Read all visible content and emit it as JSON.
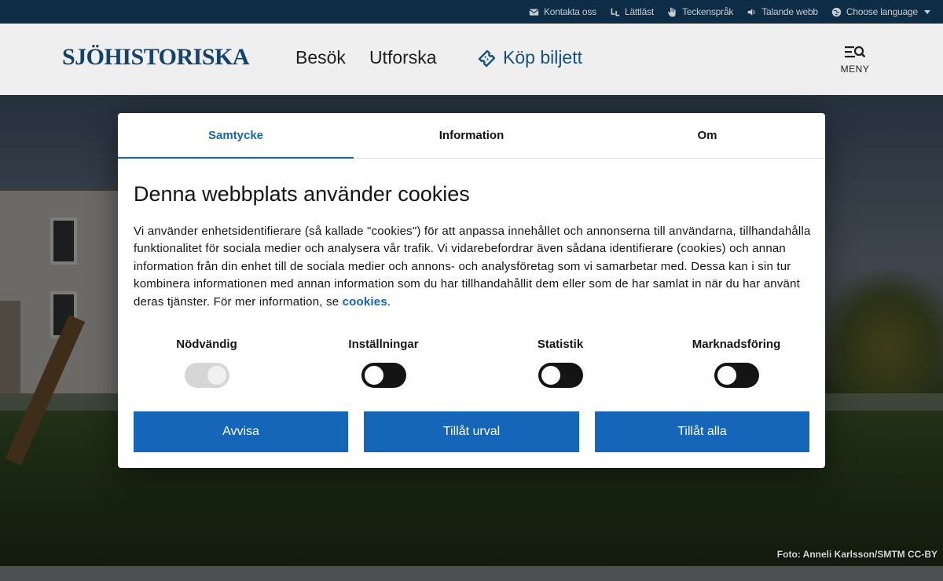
{
  "utility_bar": {
    "items": [
      {
        "label": "Kontakta oss",
        "icon": "mail-icon"
      },
      {
        "label": "Lättläst",
        "icon": "easy-read-icon"
      },
      {
        "label": "Teckenspråk",
        "icon": "sign-language-icon"
      },
      {
        "label": "Talande webb",
        "icon": "speaker-icon"
      },
      {
        "label": "Choose language",
        "icon": "globe-icon"
      }
    ]
  },
  "header": {
    "logo": "SJÖHISTORISKA",
    "nav": [
      "Besök",
      "Utforska"
    ],
    "ticket_label": "Köp biljett",
    "menu_label": "MENY"
  },
  "hero": {
    "photo_credit": "Foto: Anneli Karlsson/SMTM CC-BY"
  },
  "cookie_dialog": {
    "tabs": [
      {
        "label": "Samtycke",
        "active": true
      },
      {
        "label": "Information",
        "active": false
      },
      {
        "label": "Om",
        "active": false
      }
    ],
    "title": "Denna webbplats använder cookies",
    "body": "Vi använder enhetsidentifierare (så kallade \"cookies\") för att anpassa innehållet och annonserna till användarna, tillhandahålla funktionalitet för sociala medier och analysera vår trafik. Vi vidarebefordrar även sådana identifierare (cookies) och annan information från din enhet till de sociala medier och annons- och analysföretag som vi samarbetar med. Dessa kan i sin tur kombinera informationen med annan information som du har tillhandahållit dem eller som de har samlat in när du har använt deras tjänster. För mer information, se",
    "body_link": "cookies",
    "body_end": ".",
    "toggles": [
      {
        "label": "Nödvändig",
        "checked": true,
        "disabled": true
      },
      {
        "label": "Inställningar",
        "checked": false,
        "disabled": false
      },
      {
        "label": "Statistik",
        "checked": false,
        "disabled": false
      },
      {
        "label": "Marknadsföring",
        "checked": false,
        "disabled": false
      }
    ],
    "buttons": {
      "reject": "Avvisa",
      "allow_selection": "Tillåt urval",
      "allow_all": "Tillåt alla"
    }
  },
  "colors": {
    "utility_bar_bg": "#0d2d46",
    "brand_blue": "#13436b",
    "accent_blue": "#1565b8",
    "header_bg": "#efefef"
  }
}
